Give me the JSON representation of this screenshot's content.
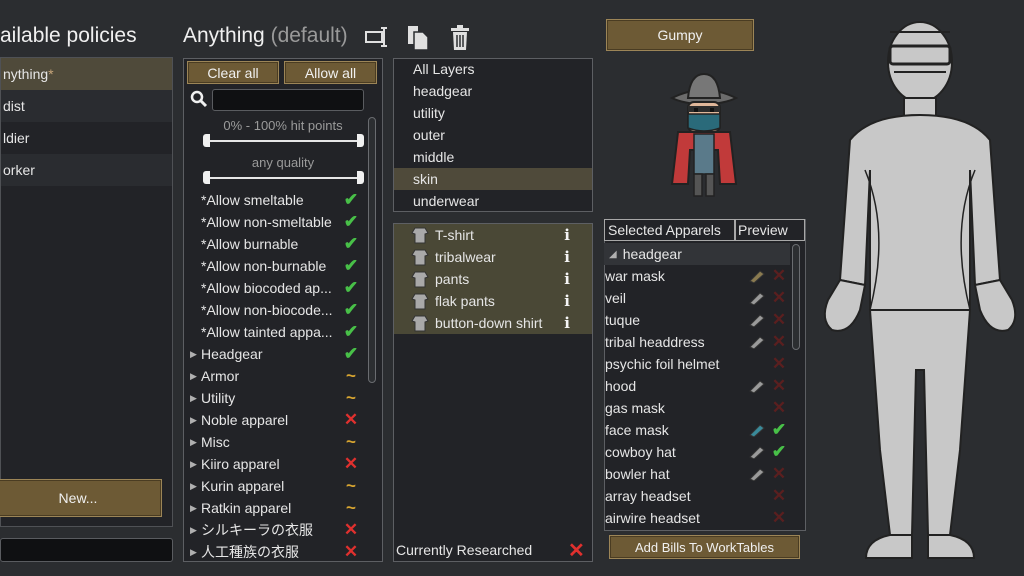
{
  "left": {
    "title": "ailable policies",
    "policies": [
      {
        "label": "nything",
        "star": "*",
        "selected": true
      },
      {
        "label": "dist",
        "star": ""
      },
      {
        "label": "ldier",
        "star": ""
      },
      {
        "label": "orker",
        "star": ""
      }
    ],
    "new_label": "New..."
  },
  "policy": {
    "name": "Anything",
    "default_tag": "(default)",
    "tools": [
      "rename-icon",
      "copy-icon",
      "delete-icon"
    ]
  },
  "filter": {
    "clear_all": "Clear all",
    "allow_all": "Allow all",
    "hitpoints_label": "0% - 100% hit points",
    "quality_label": "any quality",
    "items": [
      {
        "label": "*Allow smeltable",
        "expandable": false,
        "state": "allow"
      },
      {
        "label": "*Allow non-smeltable",
        "expandable": false,
        "state": "allow"
      },
      {
        "label": "*Allow burnable",
        "expandable": false,
        "state": "allow"
      },
      {
        "label": "*Allow non-burnable",
        "expandable": false,
        "state": "allow"
      },
      {
        "label": "*Allow biocoded ap...",
        "expandable": false,
        "state": "allow"
      },
      {
        "label": "*Allow non-biocode...",
        "expandable": false,
        "state": "allow"
      },
      {
        "label": "*Allow tainted appa...",
        "expandable": false,
        "state": "allow"
      },
      {
        "label": "Headgear",
        "expandable": true,
        "state": "allow"
      },
      {
        "label": "Armor",
        "expandable": true,
        "state": "partial"
      },
      {
        "label": "Utility",
        "expandable": true,
        "state": "partial"
      },
      {
        "label": "Noble apparel",
        "expandable": true,
        "state": "deny"
      },
      {
        "label": "Misc",
        "expandable": true,
        "state": "partial"
      },
      {
        "label": "Kiiro apparel",
        "expandable": true,
        "state": "deny"
      },
      {
        "label": "Kurin apparel",
        "expandable": true,
        "state": "partial"
      },
      {
        "label": "Ratkin apparel",
        "expandable": true,
        "state": "partial"
      },
      {
        "label": "シルキーラの衣服",
        "expandable": true,
        "state": "deny"
      },
      {
        "label": "人工種族の衣服",
        "expandable": true,
        "state": "deny"
      }
    ]
  },
  "layers": [
    "All Layers",
    "headgear",
    "utility",
    "outer",
    "middle",
    "skin",
    "underwear"
  ],
  "layers_selected": "skin",
  "apparel": {
    "items": [
      "T-shirt",
      "tribalwear",
      "pants",
      "flak pants",
      "button-down shirt"
    ],
    "info_glyph": "i",
    "researched_label": "Currently Researched"
  },
  "pawn": {
    "name": "Gumpy"
  },
  "selected": {
    "col1": "Selected Apparels",
    "col2": "Preview",
    "group": "headgear",
    "rows": [
      {
        "label": "war mask",
        "preview": "bat",
        "mark": "deny"
      },
      {
        "label": "veil",
        "preview": "gray",
        "mark": "deny"
      },
      {
        "label": "tuque",
        "preview": "gray",
        "mark": "deny"
      },
      {
        "label": "tribal headdress",
        "preview": "gray",
        "mark": "deny"
      },
      {
        "label": "psychic foil helmet",
        "preview": "",
        "mark": "deny"
      },
      {
        "label": "hood",
        "preview": "gray",
        "mark": "deny"
      },
      {
        "label": "gas mask",
        "preview": "",
        "mark": "deny"
      },
      {
        "label": "face mask",
        "preview": "teal",
        "mark": "allow"
      },
      {
        "label": "cowboy hat",
        "preview": "gray",
        "mark": "allow"
      },
      {
        "label": "bowler hat",
        "preview": "gray",
        "mark": "deny"
      },
      {
        "label": "array headset",
        "preview": "",
        "mark": "deny"
      },
      {
        "label": "airwire headset",
        "preview": "",
        "mark": "deny"
      }
    ],
    "add_bills": "Add Bills To WorkTables"
  },
  "colors": {
    "background": "#2b2d30",
    "accent_button": "#6d5a35",
    "selected_row": "#4f4a3a",
    "allow": "#48c048",
    "deny": "#e0302e",
    "partial": "#d8a530"
  }
}
